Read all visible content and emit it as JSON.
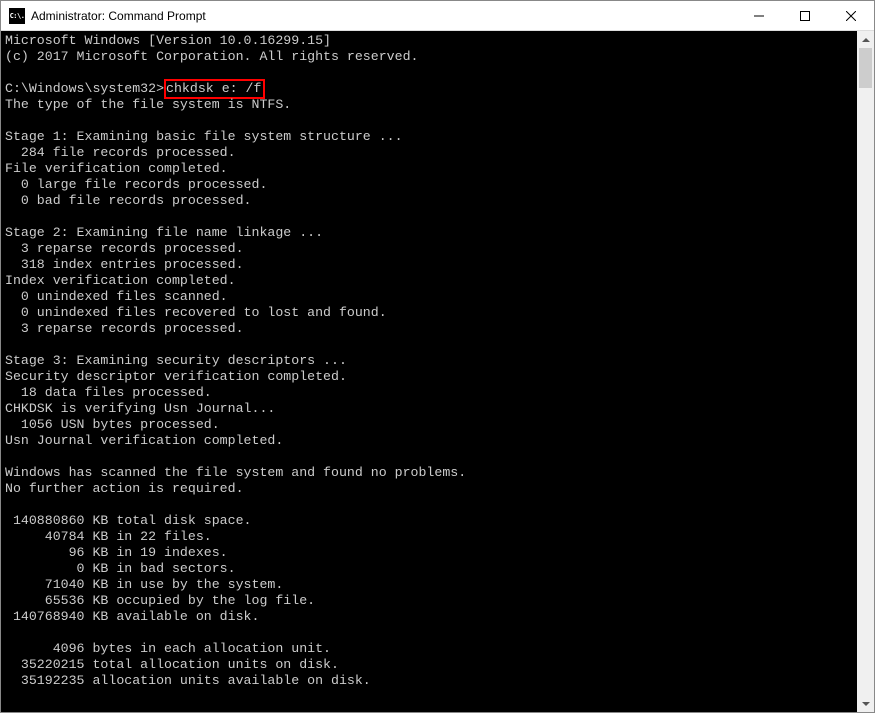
{
  "window": {
    "icon_text": "C:\\.",
    "title": "Administrator: Command Prompt"
  },
  "prompt": {
    "path": "C:\\Windows\\system32>",
    "command": "chkdsk e: /f"
  },
  "output": {
    "l1": "Microsoft Windows [Version 10.0.16299.15]",
    "l2": "(c) 2017 Microsoft Corporation. All rights reserved.",
    "l3": "The type of the file system is NTFS.",
    "s1a": "Stage 1: Examining basic file system structure ...",
    "s1b": "  284 file records processed.",
    "s1c": "File verification completed.",
    "s1d": "  0 large file records processed.",
    "s1e": "  0 bad file records processed.",
    "s2a": "Stage 2: Examining file name linkage ...",
    "s2b": "  3 reparse records processed.",
    "s2c": "  318 index entries processed.",
    "s2d": "Index verification completed.",
    "s2e": "  0 unindexed files scanned.",
    "s2f": "  0 unindexed files recovered to lost and found.",
    "s2g": "  3 reparse records processed.",
    "s3a": "Stage 3: Examining security descriptors ...",
    "s3b": "Security descriptor verification completed.",
    "s3c": "  18 data files processed.",
    "s3d": "CHKDSK is verifying Usn Journal...",
    "s3e": "  1056 USN bytes processed.",
    "s3f": "Usn Journal verification completed.",
    "r1": "Windows has scanned the file system and found no problems.",
    "r2": "No further action is required.",
    "d1": " 140880860 KB total disk space.",
    "d2": "     40784 KB in 22 files.",
    "d3": "        96 KB in 19 indexes.",
    "d4": "         0 KB in bad sectors.",
    "d5": "     71040 KB in use by the system.",
    "d6": "     65536 KB occupied by the log file.",
    "d7": " 140768940 KB available on disk.",
    "a1": "      4096 bytes in each allocation unit.",
    "a2": "  35220215 total allocation units on disk.",
    "a3": "  35192235 allocation units available on disk."
  }
}
